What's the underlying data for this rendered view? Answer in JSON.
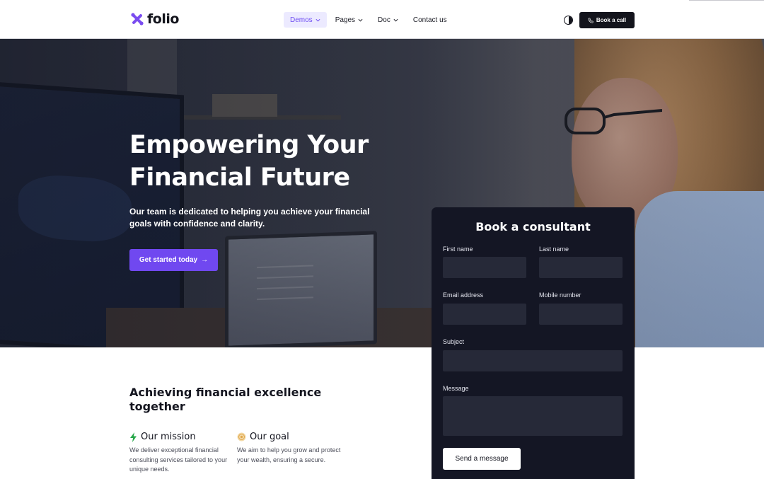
{
  "brand": {
    "name": "folio",
    "accent": "#6f4ef2"
  },
  "nav": {
    "items": [
      {
        "label": "Demos",
        "has_dropdown": true,
        "active": true
      },
      {
        "label": "Pages",
        "has_dropdown": true,
        "active": false
      },
      {
        "label": "Doc",
        "has_dropdown": true,
        "active": false
      },
      {
        "label": "Contact us",
        "has_dropdown": false,
        "active": false
      }
    ],
    "theme_toggle_icon": "contrast-icon",
    "book_call_label": "Book a call",
    "book_call_icon": "phone-icon"
  },
  "hero": {
    "title_line1": "Empowering Your",
    "title_line2_light": "Financial",
    "title_line2_bold": "Future",
    "subtitle": "Our team is dedicated to helping you achieve your financial goals with confidence and clarity.",
    "cta_label": "Get started today",
    "cta_arrow": "→"
  },
  "form": {
    "title": "Book a consultant",
    "fields": {
      "first_name": {
        "label": "First name",
        "value": ""
      },
      "last_name": {
        "label": "Last name",
        "value": ""
      },
      "email": {
        "label": "Email address",
        "value": ""
      },
      "mobile": {
        "label": "Mobile number",
        "value": ""
      },
      "subject": {
        "label": "Subject",
        "value": ""
      },
      "message": {
        "label": "Message",
        "value": ""
      }
    },
    "submit_label": "Send a message"
  },
  "about": {
    "title": "Achieving financial excellence together",
    "features": [
      {
        "icon": "lightning-icon",
        "title": "Our mission",
        "text": "We deliver exceptional financial consulting services tailored to your unique needs."
      },
      {
        "icon": "target-icon",
        "title": "Our goal",
        "text": "We aim to help you grow and protect your wealth, ensuring a secure."
      }
    ]
  }
}
